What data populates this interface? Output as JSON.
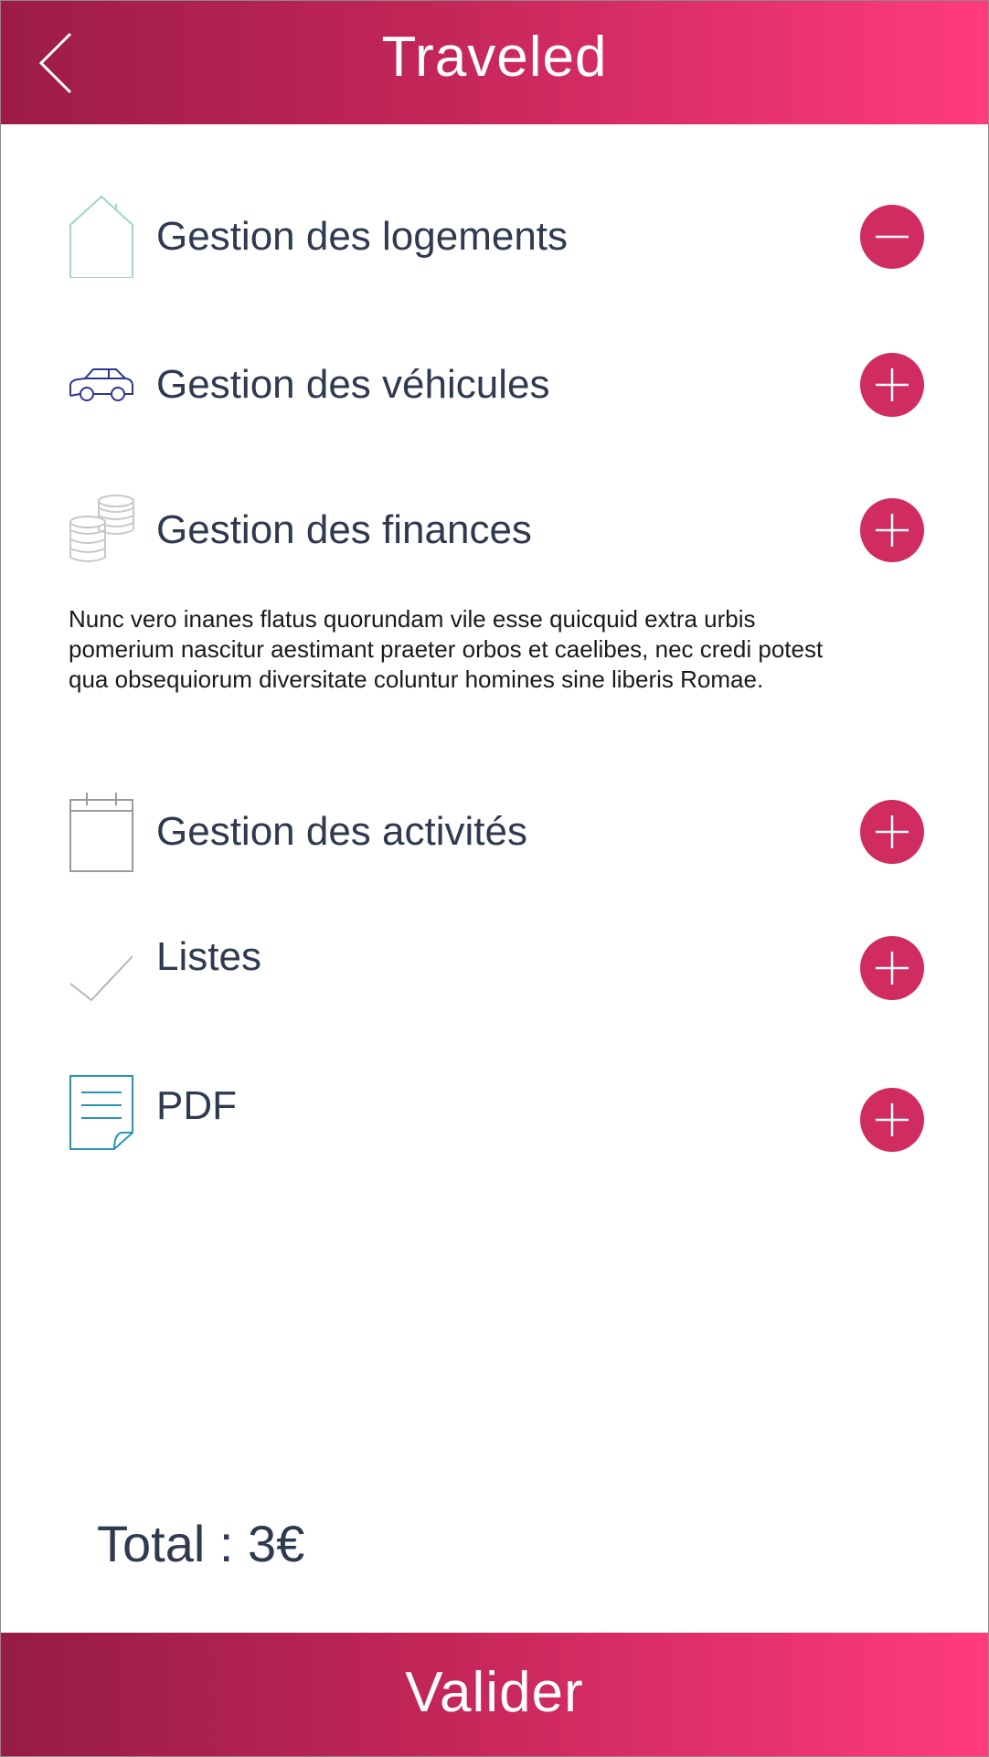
{
  "header": {
    "title": "Traveled",
    "back_icon": "chevron-left-icon"
  },
  "sections": [
    {
      "label": "Gestion des logements",
      "icon": "house-icon",
      "action": "minus"
    },
    {
      "label": "Gestion des véhicules",
      "icon": "car-icon",
      "action": "plus"
    },
    {
      "label": "Gestion des finances",
      "icon": "coins-icon",
      "action": "plus"
    },
    {
      "label": "Gestion des activités",
      "icon": "calendar-icon",
      "action": "plus"
    },
    {
      "label": "Listes",
      "icon": "checkmark-icon",
      "action": "plus"
    },
    {
      "label": "PDF",
      "icon": "document-icon",
      "action": "plus"
    }
  ],
  "finances_description": "Nunc vero inanes flatus quorundam vile esse quicquid extra urbis pomerium nascitur aestimant praeter orbos et caelibes, nec credi potest qua obsequiorum diversitate coluntur homines sine liberis Romae.",
  "total": {
    "text": "Total : 3€"
  },
  "footer": {
    "button_label": "Valider"
  },
  "colors": {
    "accent": "#d12c60",
    "gradient_start": "#9c1c48",
    "gradient_end": "#ff3b7e",
    "text_dark": "#2e3a4f"
  }
}
